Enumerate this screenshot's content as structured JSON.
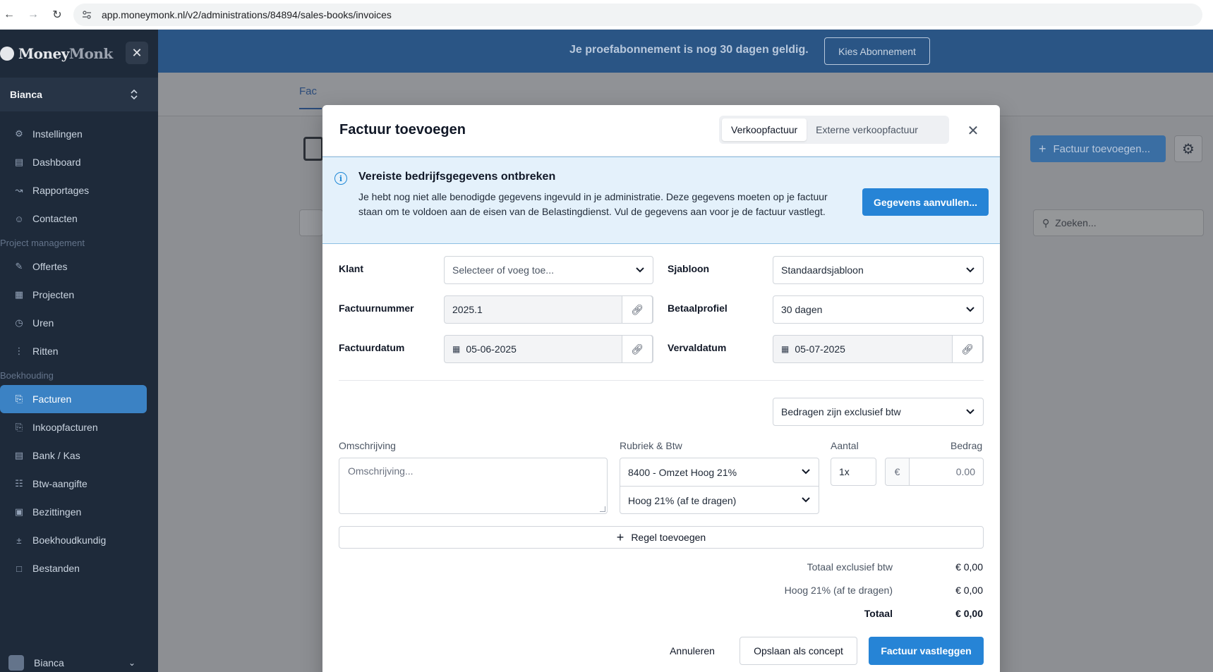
{
  "browser": {
    "url": "app.moneymonk.nl/v2/administrations/84894/sales-books/invoices"
  },
  "sidebar": {
    "logo_money": "Money",
    "logo_monk": "Monk",
    "user": "Bianca",
    "items": [
      {
        "label": "Instellingen",
        "icon": "gear-icon"
      },
      {
        "label": "Dashboard",
        "icon": "dashboard-icon"
      },
      {
        "label": "Rapportages",
        "icon": "chart-icon"
      },
      {
        "label": "Contacten",
        "icon": "contacts-icon"
      }
    ],
    "section_project": "Project management",
    "project_items": [
      {
        "label": "Offertes",
        "icon": "quote-icon"
      },
      {
        "label": "Projecten",
        "icon": "projects-icon"
      },
      {
        "label": "Uren",
        "icon": "clock-icon"
      },
      {
        "label": "Ritten",
        "icon": "route-icon"
      }
    ],
    "section_booking": "Boekhouding",
    "booking_items": [
      {
        "label": "Facturen",
        "icon": "invoice-icon",
        "active": true
      },
      {
        "label": "Inkoopfacturen",
        "icon": "purchase-icon"
      },
      {
        "label": "Bank / Kas",
        "icon": "bank-icon"
      },
      {
        "label": "Btw-aangifte",
        "icon": "tax-icon"
      },
      {
        "label": "Bezittingen",
        "icon": "assets-icon"
      },
      {
        "label": "Boekhoudkundig",
        "icon": "ledger-icon"
      },
      {
        "label": "Bestanden",
        "icon": "folder-icon"
      }
    ],
    "footer_user": "Bianca"
  },
  "trial": {
    "text": "Je proefabonnement is nog 30 dagen geldig.",
    "button": "Kies Abonnement"
  },
  "background": {
    "tab_partial": "Fac",
    "add_button": "Factuur toevoegen...",
    "search_placeholder": "Zoeken..."
  },
  "modal": {
    "title": "Factuur toevoegen",
    "seg_options": [
      "Verkoopfactuur",
      "Externe verkoopfactuur"
    ],
    "alert": {
      "title": "Vereiste bedrijfsgegevens ontbreken",
      "body": "Je hebt nog niet alle benodigde gegevens ingevuld in je administratie. Deze gegevens moeten op je factuur staan om te voldoen aan de eisen van de Belastingdienst. Vul de gegevens aan voor je de factuur vastlegt.",
      "button": "Gegevens aanvullen..."
    },
    "fields": {
      "klant_label": "Klant",
      "klant_placeholder": "Selecteer of voeg toe...",
      "sjabloon_label": "Sjabloon",
      "sjabloon_value": "Standaardsjabloon",
      "factuurnummer_label": "Factuurnummer",
      "factuurnummer_value": "2025.1",
      "betaalprofiel_label": "Betaalprofiel",
      "betaalprofiel_value": "30 dagen",
      "factuurdatum_label": "Factuurdatum",
      "factuurdatum_value": "05-06-2025",
      "vervaldatum_label": "Vervaldatum",
      "vervaldatum_value": "05-07-2025"
    },
    "btw_mode": "Bedragen zijn exclusief btw",
    "line": {
      "col_description": "Omschrijving",
      "col_category": "Rubriek & Btw",
      "col_qty": "Aantal",
      "col_amount": "Bedrag",
      "description_placeholder": "Omschrijving...",
      "category": "8400 - Omzet Hoog 21%",
      "vat": "Hoog 21% (af te dragen)",
      "qty": "1x",
      "currency": "€",
      "amount_placeholder": "0.00"
    },
    "add_line": "Regel toevoegen",
    "totals": [
      {
        "label": "Totaal exclusief btw",
        "value": "€ 0,00"
      },
      {
        "label": "Hoog 21% (af te dragen)",
        "value": "€ 0,00"
      },
      {
        "label": "Totaal",
        "value": "€ 0,00"
      }
    ],
    "buttons": {
      "cancel": "Annuleren",
      "draft": "Opslaan als concept",
      "save": "Factuur vastleggen"
    }
  }
}
